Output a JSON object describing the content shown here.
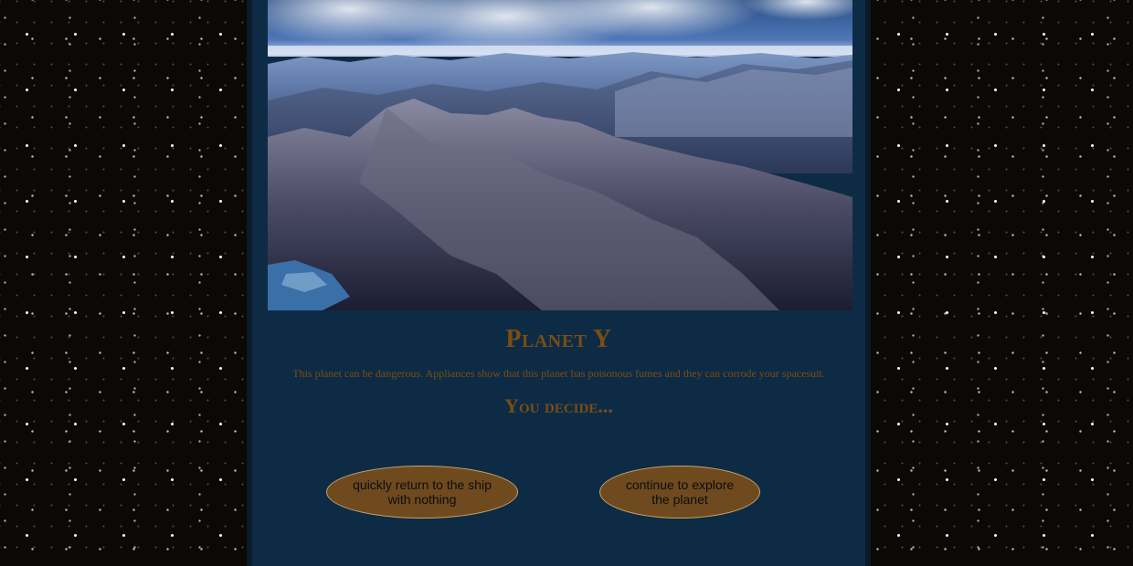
{
  "page": {
    "title": "Planet Y",
    "description": "This planet can be dangerous. Appliances show that this planet has poisonous fumes and they can corrode your spacesuit.",
    "prompt": "You decide...",
    "hero_image": "alien-mountain-landscape"
  },
  "choices": [
    {
      "label": "quickly return to the ship\nwith nothing"
    },
    {
      "label": "continue to explore\nthe planet"
    }
  ],
  "colors": {
    "panel": "#0e2b45",
    "heading": "#7a4d12",
    "button_fill": "#6e4a1e",
    "button_border": "#c9a46a"
  }
}
